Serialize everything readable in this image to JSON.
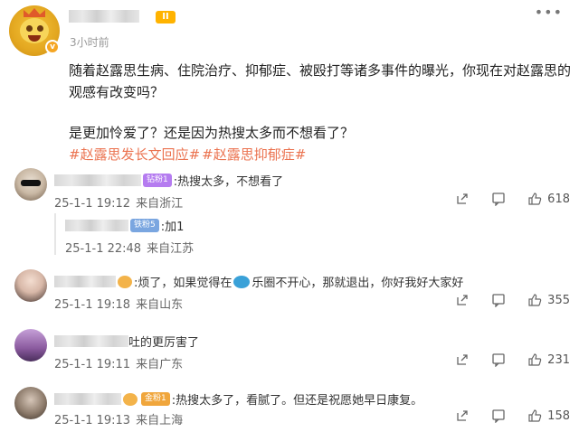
{
  "post": {
    "time": "3小时前",
    "paragraph1": "随着赵露思生病、住院治疗、抑郁症、被殴打等诸多事件的曝光，你现在对赵露思的观感有改变吗？",
    "paragraph2": "是更加怜爱了？还是因为热搜太多而不想看了？",
    "hashtags": [
      "#赵露思发长文回应#",
      "#赵露思抑郁症#"
    ],
    "level_badge": "II"
  },
  "comments": [
    {
      "badge": "钻粉1",
      "text": ":热搜太多，不想看了",
      "date": "25-1-1 19:12",
      "location": "来自浙江",
      "likes": "618",
      "reply": {
        "badge": "铁粉5",
        "text": ":加1",
        "date": "25-1-1 22:48",
        "location": "来自江苏"
      }
    },
    {
      "text_part1": ":烦了，如果觉得在",
      "text_part2": "乐圈不开心，那就退出，你好我好大家好",
      "date": "25-1-1 19:18",
      "location": "来自山东",
      "likes": "355"
    },
    {
      "text": "吐的更厉害了",
      "date": "25-1-1 19:11",
      "location": "来自广东",
      "likes": "231"
    },
    {
      "badge": "金粉1",
      "text": ":热搜太多了，看腻了。但还是祝愿她早日康复。",
      "date": "25-1-1 19:13",
      "location": "来自上海",
      "likes": "158"
    }
  ],
  "colors": {
    "hashtag": "#eb7350",
    "meta": "#666666",
    "diamond_badge": "#b57cf0",
    "iron_badge": "#7aa6e0",
    "gold_badge": "#f0a63c"
  },
  "icons": [
    "more-icon",
    "share-icon",
    "comment-icon",
    "like-icon"
  ]
}
